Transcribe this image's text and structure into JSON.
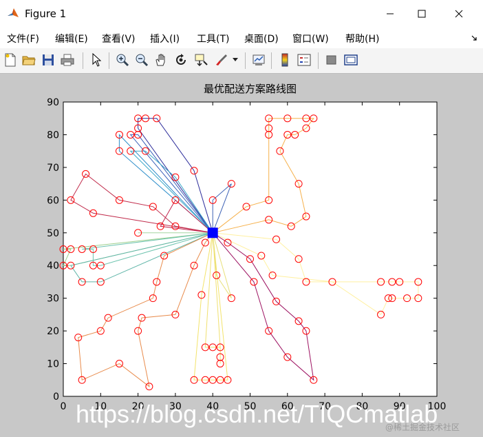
{
  "window": {
    "title": "Figure 1",
    "controls": [
      "minimize",
      "maximize",
      "close"
    ]
  },
  "menu": [
    "文件(F)",
    "编辑(E)",
    "查看(V)",
    "插入(I)",
    "工具(T)",
    "桌面(D)",
    "窗口(W)",
    "帮助(H)"
  ],
  "toolbar": {
    "icons": [
      "new-figure-icon",
      "open-file-icon",
      "save-icon",
      "print-icon",
      "pointer-icon",
      "zoom-in-icon",
      "zoom-out-icon",
      "pan-hand-icon",
      "rotate-3d-icon",
      "data-cursor-icon",
      "brush-icon",
      "dropdown-arrow-icon",
      "link-plot-icon",
      "colorbar-icon",
      "legend-icon",
      "hide-plot-tools-icon",
      "show-plot-tools-icon"
    ]
  },
  "chart_data": {
    "type": "line",
    "title": "最优配送方案路线图",
    "xlim": [
      0,
      100
    ],
    "ylim": [
      0,
      90
    ],
    "xticks": [
      0,
      10,
      20,
      30,
      40,
      50,
      60,
      70,
      80,
      90,
      100
    ],
    "yticks": [
      0,
      10,
      20,
      30,
      40,
      50,
      60,
      70,
      80,
      90
    ],
    "grid": false,
    "depot": {
      "x": 40,
      "y": 50,
      "marker": "filled-square",
      "color": "#0000ff"
    },
    "customer_marker": {
      "shape": "circle",
      "color": "#ff0000"
    },
    "routes": [
      {
        "color": "#2c2c9a",
        "points": [
          [
            40,
            50
          ],
          [
            35,
            69
          ],
          [
            25,
            85
          ],
          [
            22,
            85
          ],
          [
            20,
            85
          ],
          [
            20,
            82
          ],
          [
            40,
            50
          ]
        ]
      },
      {
        "color": "#3a5fb8",
        "points": [
          [
            40,
            50
          ],
          [
            20,
            80
          ],
          [
            18,
            80
          ],
          [
            40,
            50
          ]
        ]
      },
      {
        "color": "#2a8cc9",
        "points": [
          [
            40,
            50
          ],
          [
            15,
            80
          ],
          [
            15,
            75
          ],
          [
            40,
            50
          ]
        ]
      },
      {
        "color": "#3aa8c8",
        "points": [
          [
            40,
            50
          ],
          [
            30,
            67
          ],
          [
            22,
            75
          ],
          [
            18,
            75
          ],
          [
            40,
            50
          ]
        ]
      },
      {
        "color": "#3d62b5",
        "points": [
          [
            40,
            50
          ],
          [
            40,
            60
          ],
          [
            45,
            65
          ],
          [
            40,
            50
          ]
        ]
      },
      {
        "color": "#c02a4a",
        "points": [
          [
            40,
            50
          ],
          [
            8,
            56
          ],
          [
            2,
            60
          ],
          [
            6,
            68
          ],
          [
            15,
            60
          ],
          [
            24,
            58
          ],
          [
            30,
            52
          ],
          [
            40,
            50
          ]
        ]
      },
      {
        "color": "#c0204a",
        "points": [
          [
            40,
            50
          ],
          [
            30,
            60
          ],
          [
            26,
            52
          ],
          [
            40,
            50
          ]
        ]
      },
      {
        "color": "#9ccf8c",
        "points": [
          [
            40,
            50
          ],
          [
            0,
            45
          ],
          [
            2,
            45
          ],
          [
            0,
            40
          ],
          [
            2,
            40
          ],
          [
            40,
            50
          ]
        ]
      },
      {
        "color": "#a6d6a0",
        "points": [
          [
            40,
            50
          ],
          [
            20,
            50
          ],
          [
            40,
            50
          ]
        ]
      },
      {
        "color": "#6cc3ae",
        "points": [
          [
            40,
            50
          ],
          [
            5,
            45
          ],
          [
            8,
            45
          ],
          [
            8,
            40
          ],
          [
            10,
            40
          ],
          [
            40,
            50
          ]
        ]
      },
      {
        "color": "#5fb5a8",
        "points": [
          [
            40,
            50
          ],
          [
            10,
            35
          ],
          [
            5,
            35
          ],
          [
            2,
            40
          ],
          [
            40,
            50
          ]
        ]
      },
      {
        "color": "#e88a4a",
        "points": [
          [
            40,
            50
          ],
          [
            27,
            43
          ],
          [
            25,
            35
          ],
          [
            24,
            30
          ],
          [
            12,
            24
          ],
          [
            10,
            20
          ],
          [
            4,
            18
          ],
          [
            5,
            5
          ],
          [
            15,
            10
          ],
          [
            23,
            3
          ],
          [
            20,
            20
          ],
          [
            21,
            24
          ],
          [
            30,
            25
          ],
          [
            35,
            40
          ],
          [
            38,
            47
          ],
          [
            40,
            50
          ]
        ]
      },
      {
        "color": "#f3e36a",
        "points": [
          [
            40,
            50
          ],
          [
            37,
            31
          ],
          [
            35,
            5
          ],
          [
            38,
            5
          ],
          [
            40,
            5
          ],
          [
            42,
            5
          ],
          [
            44,
            5
          ],
          [
            40,
            50
          ]
        ]
      },
      {
        "color": "#f0e070",
        "points": [
          [
            40,
            50
          ],
          [
            38,
            15
          ],
          [
            40,
            15
          ],
          [
            42,
            15
          ],
          [
            42,
            12
          ],
          [
            42,
            10
          ],
          [
            42,
            15
          ],
          [
            40,
            50
          ]
        ]
      },
      {
        "color": "#e8e07a",
        "points": [
          [
            40,
            50
          ],
          [
            41,
            37
          ],
          [
            45,
            30
          ],
          [
            40,
            50
          ]
        ]
      },
      {
        "color": "#f6b04a",
        "points": [
          [
            40,
            50
          ],
          [
            49,
            58
          ],
          [
            55,
            60
          ],
          [
            55,
            80
          ],
          [
            55,
            82
          ],
          [
            55,
            85
          ],
          [
            60,
            85
          ],
          [
            65,
            85
          ],
          [
            67,
            85
          ],
          [
            65,
            82
          ],
          [
            62,
            80
          ],
          [
            60,
            80
          ],
          [
            58,
            75
          ],
          [
            63,
            65
          ],
          [
            65,
            55
          ],
          [
            61,
            52
          ],
          [
            55,
            54
          ],
          [
            40,
            50
          ]
        ]
      },
      {
        "color": "#fff0a0",
        "points": [
          [
            40,
            50
          ],
          [
            57,
            48
          ],
          [
            63,
            42
          ],
          [
            65,
            35
          ],
          [
            72,
            35
          ],
          [
            85,
            35
          ],
          [
            88,
            35
          ],
          [
            90,
            35
          ],
          [
            95,
            35
          ],
          [
            95,
            30
          ],
          [
            92,
            30
          ],
          [
            88,
            30
          ],
          [
            87,
            30
          ],
          [
            85,
            25
          ],
          [
            72,
            35
          ],
          [
            56,
            37
          ],
          [
            53,
            43
          ],
          [
            40,
            50
          ]
        ]
      },
      {
        "color": "#9c1060",
        "points": [
          [
            40,
            50
          ],
          [
            44,
            47
          ],
          [
            50,
            42
          ],
          [
            57,
            29
          ],
          [
            63,
            23
          ],
          [
            65,
            20
          ],
          [
            67,
            5
          ],
          [
            60,
            12
          ],
          [
            55,
            20
          ],
          [
            51,
            35
          ],
          [
            40,
            50
          ]
        ]
      }
    ]
  },
  "watermark": "https://blog.csdn.net/TIQCmatlab",
  "watermark_small": "@稀土掘金技术社区"
}
